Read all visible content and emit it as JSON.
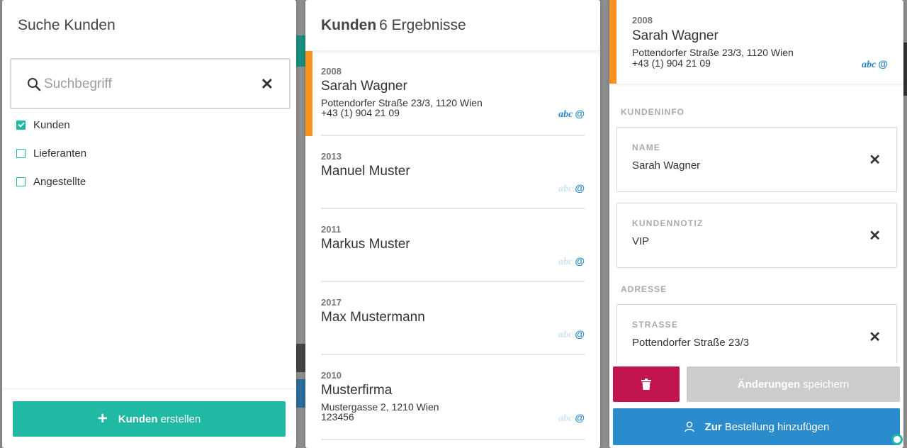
{
  "search_panel": {
    "title": "Suche Kunden",
    "search": {
      "placeholder": "Suchbegriff",
      "value": "",
      "clear_symbol": "✕"
    },
    "filters": [
      {
        "label": "Kunden",
        "checked": true
      },
      {
        "label": "Lieferanten",
        "checked": false
      },
      {
        "label": "Angestellte",
        "checked": false
      }
    ],
    "create_button": {
      "icon": "+",
      "bold": "Kunden",
      "text": "erstellen"
    }
  },
  "results_panel": {
    "title_bold": "Kunden",
    "title_count": "6 Ergebnisse",
    "results": [
      {
        "id": "2008",
        "name": "Sarah Wagner",
        "address": "Pottendorfer Straße 23/3, 1120 Wien",
        "phone": "+43 (1) 904 21 09",
        "selected": true,
        "abc_active": true
      },
      {
        "id": "2013",
        "name": "Manuel Muster",
        "address": "",
        "phone": "",
        "selected": false,
        "abc_active": false
      },
      {
        "id": "2011",
        "name": "Markus Muster",
        "address": "",
        "phone": "",
        "selected": false,
        "abc_active": false
      },
      {
        "id": "2017",
        "name": "Max Mustermann",
        "address": "",
        "phone": "",
        "selected": false,
        "abc_active": false
      },
      {
        "id": "2010",
        "name": "Musterfirma",
        "address": "Mustergasse 2, 1210 Wien",
        "phone": "123456",
        "selected": false,
        "abc_active": false
      }
    ],
    "badge_text": "abc",
    "badge_at": "@"
  },
  "detail_panel": {
    "id": "2008",
    "name": "Sarah Wagner",
    "address": "Pottendorfer Straße 23/3, 1120 Wien",
    "phone": "+43 (1) 904 21 09",
    "badge_text": "abc",
    "badge_at": "@",
    "section_info": "KUNDENINFO",
    "field_name": {
      "label": "NAME",
      "value": "Sarah Wagner"
    },
    "field_note": {
      "label": "KUNDENNOTIZ",
      "value": "VIP"
    },
    "section_address": "ADRESSE",
    "field_street": {
      "label": "STRASSE",
      "value": "Pottendorfer Straße 23/3"
    },
    "clear_symbol": "✕",
    "save_button": {
      "bold": "Änderungen",
      "text": "speichern"
    },
    "add_button": {
      "bold": "Zur",
      "text": "Bestellung hinzufügen"
    }
  },
  "colors": {
    "accent_teal": "#20b9a3",
    "selected_orange": "#f7931e",
    "delete_red": "#c0154d",
    "primary_blue": "#2b8ccd",
    "disabled_gray": "#cccccc"
  },
  "icons": [
    "search-icon",
    "close-icon",
    "checkbox-icon",
    "plus-icon",
    "trash-icon",
    "user-icon",
    "email-icon"
  ]
}
